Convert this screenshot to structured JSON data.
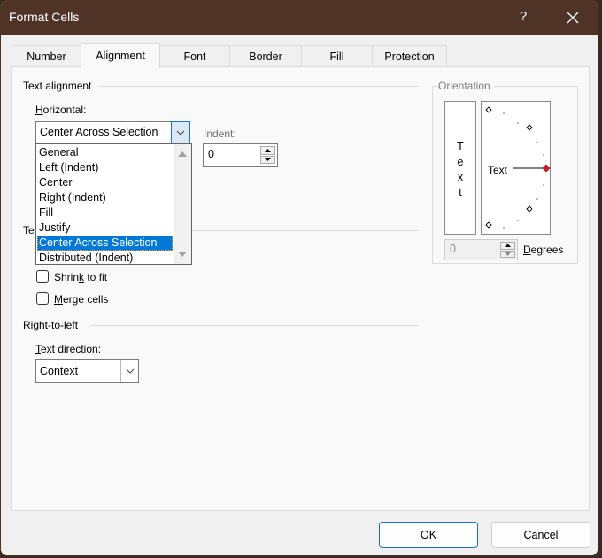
{
  "window": {
    "title": "Format Cells",
    "help_label": "?",
    "close_label": "✕"
  },
  "tabs": [
    {
      "label": "Number",
      "active": false
    },
    {
      "label": "Alignment",
      "active": true
    },
    {
      "label": "Font",
      "active": false
    },
    {
      "label": "Border",
      "active": false
    },
    {
      "label": "Fill",
      "active": false
    },
    {
      "label": "Protection",
      "active": false
    }
  ],
  "text_alignment": {
    "group_label": "Text alignment",
    "horizontal_label": "Horizontal:",
    "horizontal_value": "Center Across Selection",
    "horizontal_options": [
      "General",
      "Left (Indent)",
      "Center",
      "Right (Indent)",
      "Fill",
      "Justify",
      "Center Across Selection",
      "Distributed (Indent)"
    ],
    "horizontal_selected_index": 6,
    "indent_label": "Indent:",
    "indent_value": "0",
    "obscured_group_label_prefix": "Te"
  },
  "text_control": {
    "shrink_to_fit_label": "Shrink to fit",
    "shrink_to_fit_checked": false,
    "merge_cells_label": "Merge cells",
    "merge_cells_checked": false
  },
  "right_to_left": {
    "group_label": "Right-to-left",
    "text_direction_label": "Text direction:",
    "text_direction_value": "Context"
  },
  "orientation": {
    "group_label": "Orientation",
    "vertical_text_letters": [
      "T",
      "e",
      "x",
      "t"
    ],
    "dial_text": "Text",
    "degrees_value": "0",
    "degrees_label": "Degrees",
    "active_marker_color": "#e81123"
  },
  "footer": {
    "ok_label": "OK",
    "cancel_label": "Cancel"
  },
  "colors": {
    "titlebar": "#4e3326",
    "selection": "#0078d7",
    "focus_border": "#1b74d2"
  }
}
